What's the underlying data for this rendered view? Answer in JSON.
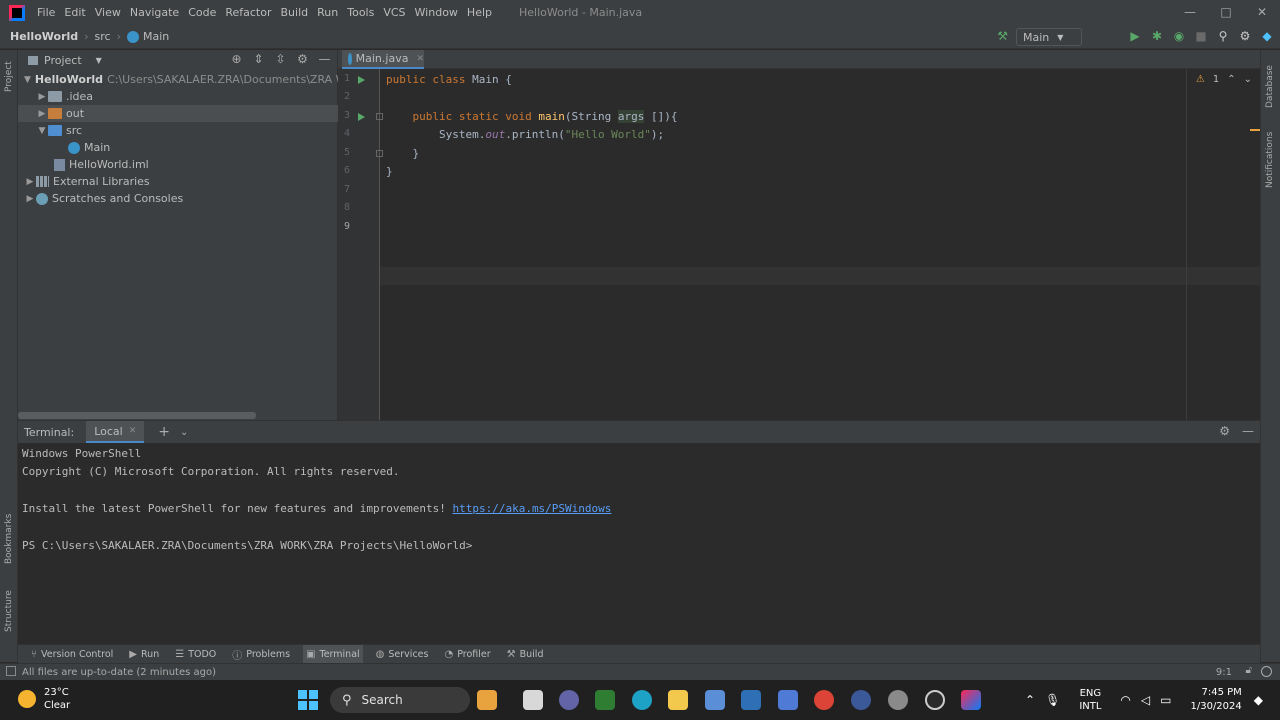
{
  "menubar": {
    "items": [
      "File",
      "Edit",
      "View",
      "Navigate",
      "Code",
      "Refactor",
      "Build",
      "Run",
      "Tools",
      "VCS",
      "Window",
      "Help"
    ],
    "title": "HelloWorld - Main.java",
    "controls": [
      "—",
      "□",
      "✕"
    ]
  },
  "navbar": {
    "project": "HelloWorld",
    "folder": "src",
    "file": "Main",
    "run_config": "Main"
  },
  "project_panel": {
    "title": "Project",
    "tree": [
      {
        "name": "HelloWorld",
        "path": "C:\\Users\\SAKALAER.ZRA\\Documents\\ZRA WORK\\Z"
      },
      {
        "name": ".idea"
      },
      {
        "name": "out"
      },
      {
        "name": "src"
      },
      {
        "name": "Main"
      },
      {
        "name": "HelloWorld.iml"
      },
      {
        "name": "External Libraries"
      },
      {
        "name": "Scratches and Consoles"
      }
    ]
  },
  "editor": {
    "tab": "Main.java",
    "line_numbers": [
      "1",
      "2",
      "3",
      "4",
      "5",
      "6",
      "7",
      "8",
      "9"
    ],
    "code": {
      "l1_kw": "public class ",
      "l1_rest": "Main {",
      "l3_kw": "public static void ",
      "l3_fn": "main",
      "l3_a": "(String ",
      "l3_args": "args",
      "l3_b": " []){",
      "l4_a": "System.",
      "l4_out": "out",
      "l4_b": ".println(",
      "l4_str": "\"Hello World\"",
      "l4_c": ");",
      "l5": "}",
      "l6": "}"
    },
    "warning_count": "1"
  },
  "right_strip": {
    "database": "Database",
    "notifications": "Notifications"
  },
  "left_strip": {
    "project": "Project",
    "bookmarks": "Bookmarks",
    "structure": "Structure"
  },
  "terminal": {
    "label": "Terminal:",
    "tab": "Local",
    "lines": {
      "l1": "Windows PowerShell",
      "l2": "Copyright (C) Microsoft Corporation. All rights reserved.",
      "l3": "Install the latest PowerShell for new features and improvements! ",
      "l3_link": "https://aka.ms/PSWindows",
      "l4": "PS C:\\Users\\SAKALAER.ZRA\\Documents\\ZRA WORK\\ZRA Projects\\HelloWorld>"
    }
  },
  "bottom_tools": [
    "Version Control",
    "Run",
    "TODO",
    "Problems",
    "Terminal",
    "Services",
    "Profiler",
    "Build"
  ],
  "statusbar": {
    "message": "All files are up-to-date (2 minutes ago)",
    "position": "9:1"
  },
  "taskbar": {
    "temperature": "23°C",
    "weather": "Clear",
    "search": "Search",
    "lang1": "ENG",
    "lang2": "INTL",
    "time": "7:45 PM",
    "date": "1/30/2024"
  },
  "colors": {
    "keyword": "#cc7832",
    "function": "#ffc66d",
    "string": "#6a8759",
    "field": "#9876aa",
    "link": "#589df6",
    "accent": "#4a88c7"
  }
}
